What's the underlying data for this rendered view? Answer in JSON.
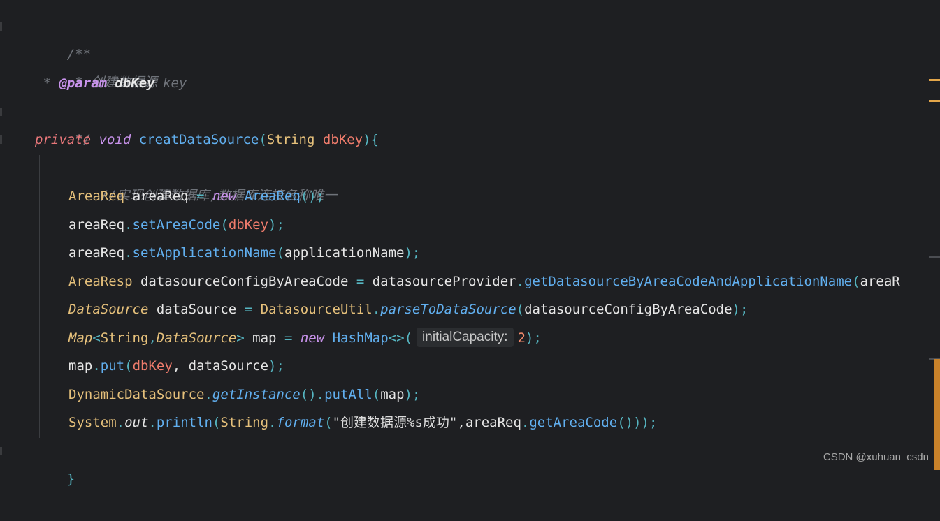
{
  "editor": {
    "lines": {
      "l1": {
        "c1": "/**"
      },
      "l2": {
        "c1": " * 创建数据源"
      },
      "l3": {
        "c1": " * ",
        "anno": "@param",
        "sp": " ",
        "name": "dbKey",
        "sp2": " ",
        "desc": "key"
      },
      "l4": {
        "c1": " */"
      },
      "l5": {
        "kw1": "private",
        "sp1": " ",
        "kw2": "void",
        "sp2": " ",
        "fn": "creatDataSource",
        "p1": "(",
        "type": "String",
        "sp3": " ",
        "param": "dbKey",
        "p2": "){"
      },
      "l6": {
        "c1": "//实现创建数据库,数据库连接名称唯一"
      },
      "l7": {
        "type": "AreaReq",
        "sp1": " ",
        "var": "areaReq",
        "eq": " = ",
        "kw": "new",
        "sp2": " ",
        "ctor": "AreaReq",
        "tail": "();"
      },
      "l8": {
        "var": "areaReq",
        "dot": ".",
        "fn": "setAreaCode",
        "p1": "(",
        "param": "dbKey",
        "p2": ");"
      },
      "l9": {
        "var": "areaReq",
        "dot": ".",
        "fn": "setApplicationName",
        "p1": "(",
        "arg": "applicationName",
        "p2": ");"
      },
      "l10": {
        "type": "AreaResp",
        "sp1": " ",
        "var": "datasourceConfigByAreaCode",
        "eq": " = ",
        "obj": "datasourceProvider",
        "dot": ".",
        "fn": "getDatasourceByAreaCodeAndApplicationName",
        "p1": "(",
        "arg": "areaR"
      },
      "l11": {
        "type": "DataSource",
        "sp1": " ",
        "var": "dataSource",
        "eq": " = ",
        "cls": "DatasourceUtil",
        "dot": ".",
        "fn": "parseToDataSource",
        "p1": "(",
        "arg": "datasourceConfigByAreaCode",
        "p2": ");"
      },
      "l12": {
        "type": "Map",
        "lt": "<",
        "t1": "String",
        "comma": ",",
        "t2": "DataSource",
        "gt": ">",
        "sp1": " ",
        "var": "map",
        "eq": " = ",
        "kw": "new",
        "sp2": " ",
        "ctor": "HashMap",
        "diamond": "<>",
        "p1": "(",
        "hint": "initialCapacity:",
        "num": "2",
        "p2": ");"
      },
      "l13": {
        "var": "map",
        "dot": ".",
        "fn": "put",
        "p1": "(",
        "param": "dbKey",
        "comma": ", ",
        "arg": "dataSource",
        "p2": ");"
      },
      "l14": {
        "cls": "DynamicDataSource",
        "dot": ".",
        "fn": "getInstance",
        "mid": "().",
        "fn2": "putAll",
        "p1": "(",
        "arg": "map",
        "p2": ");"
      },
      "l15": {
        "cls": "System",
        "dot": ".",
        "field": "out",
        "dot2": ".",
        "fn": "println",
        "p1": "(",
        "cls2": "String",
        "dot3": ".",
        "fn2": "format",
        "p2": "(",
        "str": "\"创建数据源%s成功\"",
        "comma": ",",
        "var": "areaReq",
        "dot4": ".",
        "fn3": "getAreaCode",
        "p3": "()));"
      },
      "l16": {
        "brace": "}"
      }
    }
  },
  "watermark": "CSDN @xuhuan_csdn",
  "colors": {
    "background": "#1e1f22",
    "keyword": "#e8777a",
    "type": "#e5c07b",
    "function": "#61afef",
    "comment": "#6f737a"
  }
}
